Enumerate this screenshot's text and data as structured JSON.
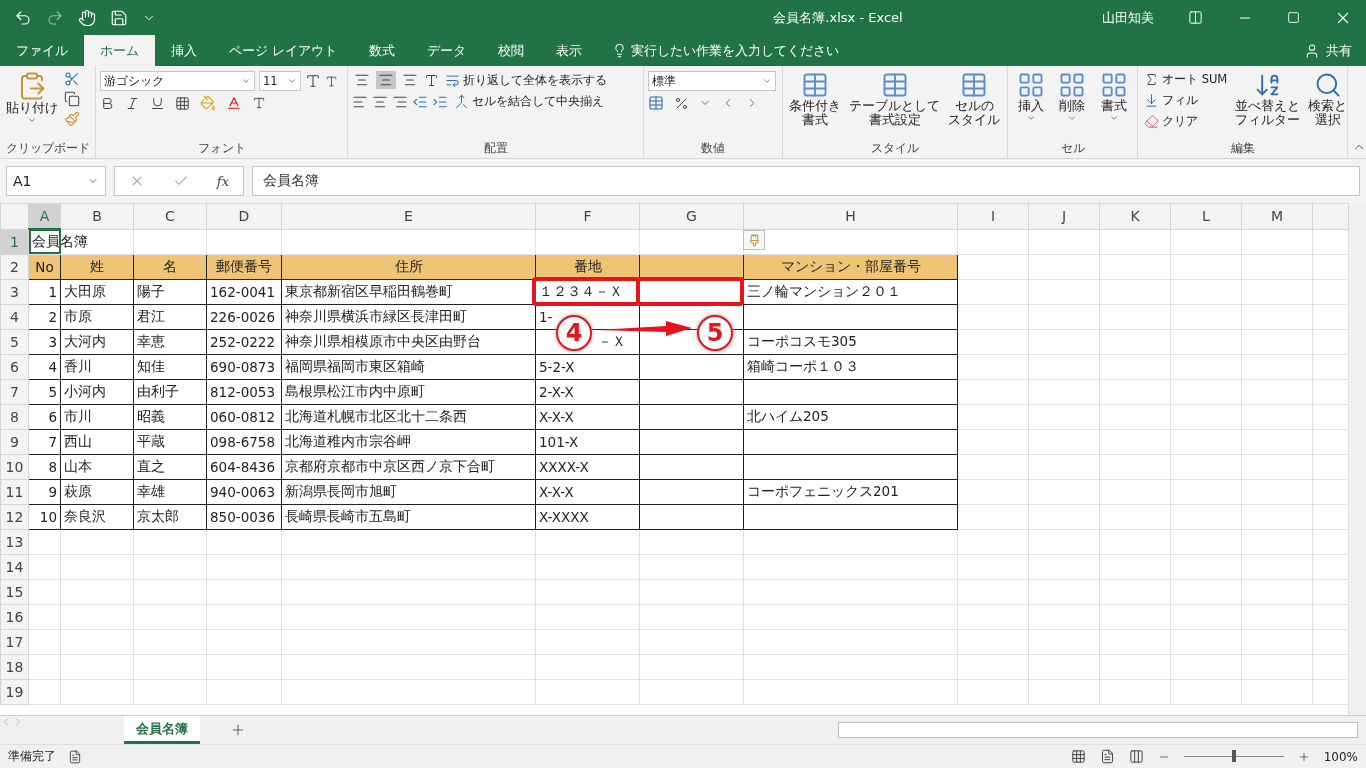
{
  "title_bar": {
    "title": "会員名簿.xlsx  -  Excel",
    "user": "山田知美"
  },
  "menu_tabs": [
    {
      "label": "ファイル",
      "selected": false
    },
    {
      "label": "ホーム",
      "selected": true
    },
    {
      "label": "挿入",
      "selected": false
    },
    {
      "label": "ページ レイアウト",
      "selected": false
    },
    {
      "label": "数式",
      "selected": false
    },
    {
      "label": "データ",
      "selected": false
    },
    {
      "label": "校閲",
      "selected": false
    },
    {
      "label": "表示",
      "selected": false
    }
  ],
  "tell_me": {
    "placeholder": "実行したい作業を入力してください"
  },
  "share": "共有",
  "ribbon": {
    "clipboard": {
      "label": "クリップボード",
      "paste": "貼り付け"
    },
    "font": {
      "label": "フォント",
      "font_name": "游ゴシック",
      "font_size": "11"
    },
    "alignment": {
      "label": "配置",
      "vertical": [
        {
          "selected": false
        },
        {
          "selected": true
        },
        {
          "selected": false
        }
      ],
      "wrap": "折り返して全体を表示する",
      "merge": "セルを結合して中央揃え"
    },
    "number": {
      "label": "数値",
      "format": "標準"
    },
    "styles": {
      "label": "スタイル",
      "buttons": [
        {
          "lines": [
            "条件付き",
            "書式"
          ]
        },
        {
          "lines": [
            "テーブルとして",
            "書式設定"
          ]
        },
        {
          "lines": [
            "セルの",
            "スタイル"
          ]
        }
      ]
    },
    "cells": {
      "label": "セル",
      "buttons": [
        "挿入",
        "削除",
        "書式"
      ]
    },
    "editing": {
      "label": "編集",
      "commands": [
        "オート SUM",
        "フィル",
        "クリア"
      ],
      "buttons": [
        {
          "lines": [
            "並べ替えと",
            "フィルター"
          ]
        },
        {
          "lines": [
            "検索と",
            "選択"
          ]
        }
      ]
    }
  },
  "formula_bar": {
    "name_box": "A1",
    "fx_label": "fx",
    "value": "会員名簿"
  },
  "sheet": {
    "columns": [
      {
        "label": "A",
        "selected": true
      },
      {
        "label": "B",
        "selected": false
      },
      {
        "label": "C",
        "selected": false
      },
      {
        "label": "D",
        "selected": false
      },
      {
        "label": "E",
        "selected": false
      },
      {
        "label": "F",
        "selected": false
      },
      {
        "label": "G",
        "selected": false
      },
      {
        "label": "H",
        "selected": false
      },
      {
        "label": "I",
        "selected": false
      },
      {
        "label": "J",
        "selected": false
      },
      {
        "label": "K",
        "selected": false
      },
      {
        "label": "L",
        "selected": false
      },
      {
        "label": "M",
        "selected": false
      }
    ],
    "rows": [
      {
        "label": "1",
        "selected": true,
        "kind": "title",
        "cells": {
          "A": "会員名簿"
        }
      },
      {
        "label": "2",
        "selected": false,
        "kind": "header",
        "cells": {
          "A": "No",
          "B": "姓",
          "C": "名",
          "D": "郵便番号",
          "E": "住所",
          "F": "番地",
          "H": "マンション・部屋番号"
        }
      },
      {
        "label": "3",
        "selected": false,
        "kind": "data",
        "cells": {
          "A": "1",
          "B": "大田原",
          "C": "陽子",
          "D": "162-0041",
          "E": "東京都新宿区早稲田鶴巻町",
          "F": "１２３４－Ｘ",
          "H": "三ノ輪マンション２０１"
        }
      },
      {
        "label": "4",
        "selected": false,
        "kind": "data",
        "cells": {
          "A": "2",
          "B": "市原",
          "C": "君江",
          "D": "226-0026",
          "E": "神奈川県横浜市緑区長津田町",
          "F": "1-"
        }
      },
      {
        "label": "5",
        "selected": false,
        "kind": "data",
        "cells": {
          "A": "3",
          "B": "大河内",
          "C": "幸恵",
          "D": "252-0222",
          "E": "神奈川県相模原市中央区由野台",
          "F": "－Ｘ",
          "H": "コーポコスモ305"
        }
      },
      {
        "label": "6",
        "selected": false,
        "kind": "data",
        "cells": {
          "A": "4",
          "B": "香川",
          "C": "知佳",
          "D": "690-0873",
          "E": "福岡県福岡市東区箱崎",
          "F": "5-2-X",
          "H": "箱崎コーポ１０３"
        }
      },
      {
        "label": "7",
        "selected": false,
        "kind": "data",
        "cells": {
          "A": "5",
          "B": "小河内",
          "C": "由利子",
          "D": "812-0053",
          "E": "島根県松江市内中原町",
          "F": "2-X-X"
        }
      },
      {
        "label": "8",
        "selected": false,
        "kind": "data",
        "cells": {
          "A": "6",
          "B": "市川",
          "C": "昭義",
          "D": "060-0812",
          "E": "北海道札幌市北区北十二条西",
          "F": "X-X-X",
          "H": "北ハイム205"
        }
      },
      {
        "label": "9",
        "selected": false,
        "kind": "data",
        "cells": {
          "A": "7",
          "B": "西山",
          "C": "平蔵",
          "D": "098-6758",
          "E": "北海道稚内市宗谷岬",
          "F": "101-X"
        }
      },
      {
        "label": "10",
        "selected": false,
        "kind": "data",
        "cells": {
          "A": "8",
          "B": "山本",
          "C": "直之",
          "D": "604-8436",
          "E": "京都府京都市中京区西ノ京下合町",
          "F": "XXXX-X"
        }
      },
      {
        "label": "11",
        "selected": false,
        "kind": "data",
        "cells": {
          "A": "9",
          "B": "萩原",
          "C": "幸雄",
          "D": "940-0063",
          "E": "新潟県長岡市旭町",
          "F": "X-X-X",
          "H": "コーポフェニックス201"
        }
      },
      {
        "label": "12",
        "selected": false,
        "kind": "data",
        "cells": {
          "A": "10",
          "B": "奈良沢",
          "C": "京太郎",
          "D": "850-0036",
          "E": "長崎県長崎市五島町",
          "F": "X-XXXX"
        }
      },
      {
        "label": "13",
        "selected": false,
        "kind": "empty"
      },
      {
        "label": "14",
        "selected": false,
        "kind": "empty"
      },
      {
        "label": "15",
        "selected": false,
        "kind": "empty"
      },
      {
        "label": "16",
        "selected": false,
        "kind": "empty"
      },
      {
        "label": "17",
        "selected": false,
        "kind": "empty"
      },
      {
        "label": "18",
        "selected": false,
        "kind": "empty"
      },
      {
        "label": "19",
        "selected": false,
        "kind": "empty"
      }
    ]
  },
  "annotation": {
    "markers": [
      "4",
      "5"
    ]
  },
  "sheet_tabs": [
    {
      "label": "会員名簿",
      "selected": true
    }
  ],
  "status_bar": {
    "status": "準備完了",
    "zoom_slider": {
      "level": 0.5
    },
    "zoom": "100%"
  }
}
